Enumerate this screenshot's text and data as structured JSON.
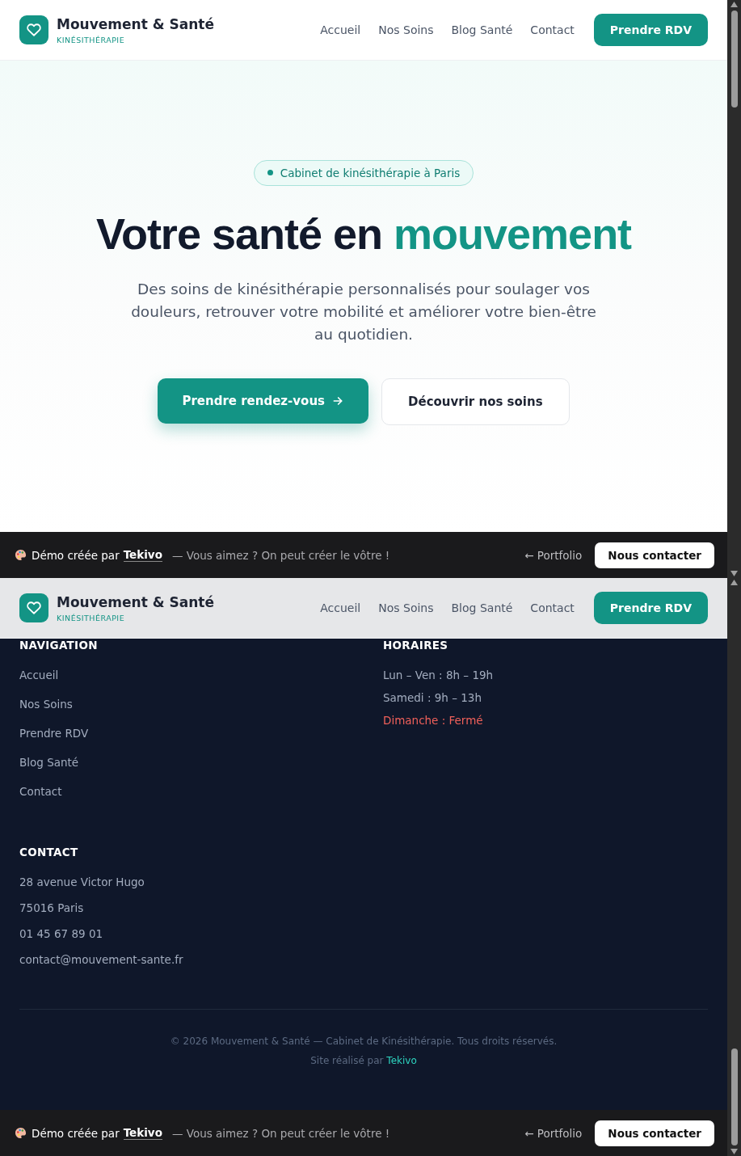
{
  "top_view": {
    "header": {
      "brand": "Mouvement & Santé",
      "tagline": "KINÉSITHÉRAPIE",
      "nav": [
        "Accueil",
        "Nos Soins",
        "Blog Santé",
        "Contact"
      ],
      "cta": "Prendre RDV"
    },
    "hero": {
      "badge": "Cabinet de kinésithérapie à Paris",
      "title_lead": "Votre santé en",
      "title_highlight": "mouvement",
      "subtitle": "Des soins de kinésithérapie personnalisés pour soulager vos douleurs, retrouver votre mobilité et améliorer votre bien-être au quotidien.",
      "primary_button": "Prendre rendez-vous",
      "secondary_button": "Découvrir nos soins"
    },
    "demo_bar": {
      "lead": "Démo créée par",
      "brand": "Tekivo",
      "tagline": "— Vous aimez ? On peut créer le vôtre !",
      "portfolio": "← Portfolio",
      "contact_button": "Nous contacter"
    }
  },
  "bottom_view": {
    "header": {
      "brand": "Mouvement & Santé",
      "tagline": "KINÉSITHÉRAPIE",
      "nav": [
        "Accueil",
        "Nos Soins",
        "Blog Santé",
        "Contact"
      ],
      "cta": "Prendre RDV"
    },
    "footer": {
      "columns": [
        {
          "heading": "NAVIGATION",
          "items": [
            {
              "text": "Accueil",
              "kind": "link"
            },
            {
              "text": "Nos Soins",
              "kind": "link"
            },
            {
              "text": "Prendre RDV",
              "kind": "link"
            },
            {
              "text": "Blog Santé",
              "kind": "link"
            },
            {
              "text": "Contact",
              "kind": "link"
            }
          ]
        },
        {
          "heading": "HORAIRES",
          "items": [
            {
              "text": "Lun – Ven : 8h – 19h",
              "kind": "open"
            },
            {
              "text": "Samedi : 9h – 13h",
              "kind": "open"
            },
            {
              "text": "Dimanche : Fermé",
              "kind": "closed"
            }
          ]
        },
        {
          "heading": "CONTACT",
          "items": [
            {
              "text": "28 avenue Victor Hugo",
              "kind": "text"
            },
            {
              "text": "75016 Paris",
              "kind": "text"
            },
            {
              "text": "01 45 67 89 01",
              "kind": "text"
            },
            {
              "text": "contact@mouvement-sante.fr",
              "kind": "text"
            }
          ]
        }
      ],
      "copyright": "© 2026 Mouvement & Santé — Cabinet de Kinésithérapie. Tous droits réservés.",
      "credit_lead": "Site réalisé par",
      "credit_link": "Tekivo"
    },
    "demo_bar": {
      "lead": "Démo créée par",
      "brand": "Tekivo",
      "tagline": "— Vous aimez ? On peut créer le vôtre !",
      "portfolio": "← Portfolio",
      "contact_button": "Nous contacter"
    }
  }
}
